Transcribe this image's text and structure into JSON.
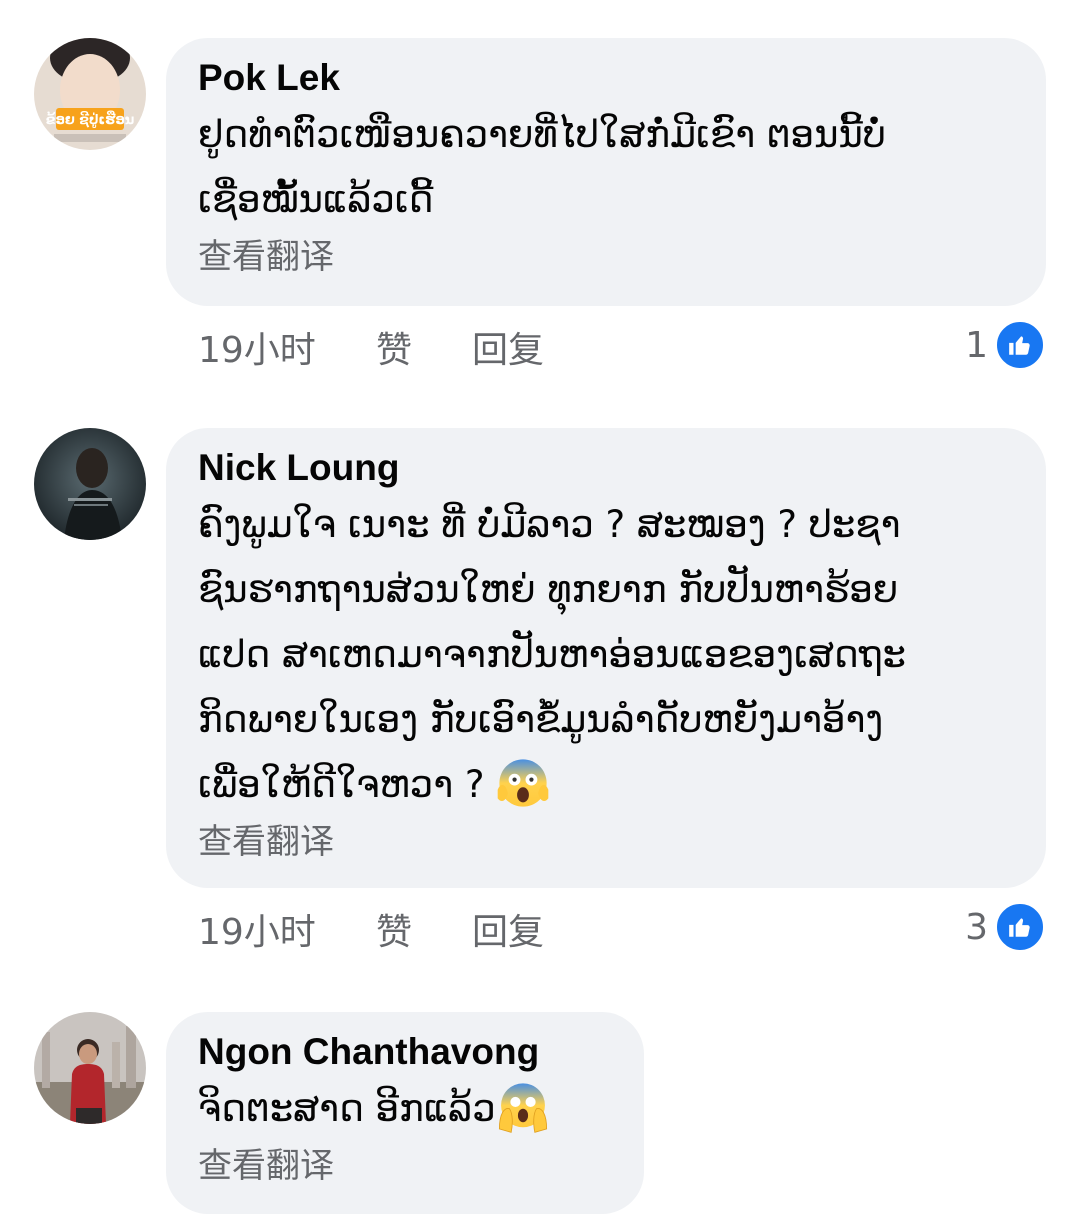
{
  "comments": [
    {
      "author": "Pok Lek",
      "avatar_caption": "ຂ້ອຍ ຊີປູ່ເຮືອນ",
      "lines": [
        "ຢູດທຳຕົວເໜືອນຄວາຍທີ່ໄປໃສກໍ່ມີເຂົາ ຕອນນີ້ບໍ່",
        "ເຊື່ອໝັ້ນແລ້ວເດີ້"
      ],
      "translate": "查看翻译",
      "time": "19小时",
      "like": "赞",
      "reply": "回复",
      "reaction_count": "1",
      "reaction_icon": "thumbs-up-icon"
    },
    {
      "author": "Nick Loung",
      "lines": [
        "ຄົງພູມໃຈ ເນາະ ທີ່ ບໍ່ມີລາວ ? ສະໝອງ ? ປະຊາ",
        "ຊົນຮາກຖານສ່ວນໃຫຍ່ ທຸກຍາກ ກັບປັນຫາຮ້ອຍ",
        "ແປດ ສາເຫດມາຈາກປັນຫາອ່ອນແອຂອງເສດຖະ",
        "ກິດພາຍໃນເອງ ກັບເອົາຂໍ້ມູນລຳດັບຫຍັງມາອ້າງ",
        "ເພື່ອໃຫ້ດີໃຈຫວາ ?"
      ],
      "trailing_emoji": "screaming-face-emoji",
      "translate": "查看翻译",
      "time": "19小时",
      "like": "赞",
      "reply": "回复",
      "reaction_count": "3",
      "reaction_icon": "thumbs-up-icon"
    },
    {
      "author": "Ngon Chanthavong",
      "lines": [
        "ຈິດຕະສາດ ອີກແລ້ວ"
      ],
      "trailing_emoji": "face-screaming-hands-emoji",
      "translate": "查看翻译"
    }
  ],
  "colors": {
    "bubble": "#f0f2f5",
    "text": "#050505",
    "secondary": "#65676b",
    "like_blue": "#1877f2"
  }
}
